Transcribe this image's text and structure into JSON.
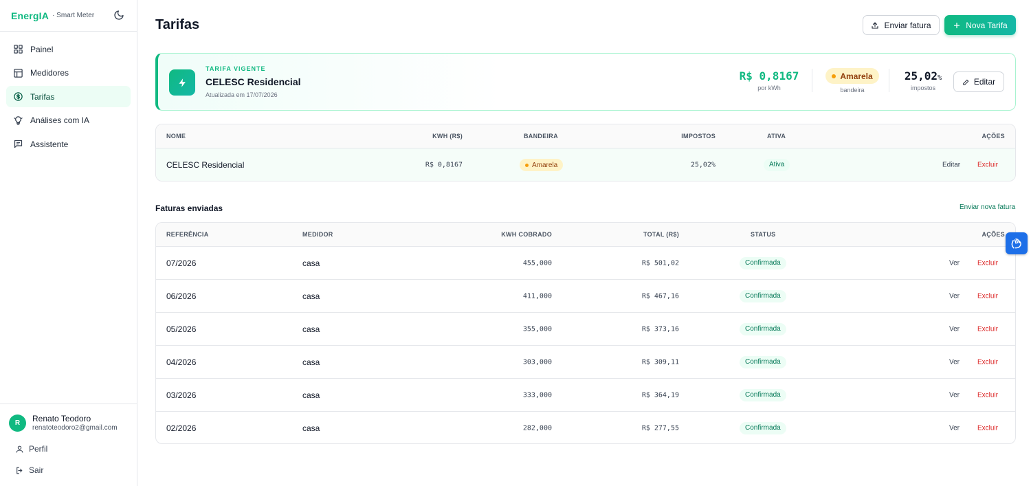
{
  "brand": {
    "name": "EnergIA",
    "subtitle": "· Smart Meter"
  },
  "sidebar": {
    "items": [
      {
        "label": "Painel",
        "icon": "grid-icon",
        "active": false
      },
      {
        "label": "Medidores",
        "icon": "table-icon",
        "active": false
      },
      {
        "label": "Tarifas",
        "icon": "dollar-circle-icon",
        "active": true
      },
      {
        "label": "Análises com IA",
        "icon": "lightbulb-icon",
        "active": false
      },
      {
        "label": "Assistente",
        "icon": "chat-icon",
        "active": false
      }
    ]
  },
  "user": {
    "initial": "R",
    "name": "Renato Teodoro",
    "email": "renatoteodoro2@gmail.com",
    "profile_label": "Perfil",
    "logout_label": "Sair"
  },
  "header": {
    "title": "Tarifas",
    "upload_label": "Enviar fatura",
    "new_label": "Nova Tarifa"
  },
  "current_tariff": {
    "label": "TARIFA VIGENTE",
    "name": "CELESC Residencial",
    "updated": "Atualizada em 17/07/2026",
    "price": "R$ 0,8167",
    "price_caption": "por kWh",
    "flag": "Amarela",
    "flag_caption": "bandeira",
    "taxes": "25,02",
    "taxes_unit": "%",
    "taxes_caption": "impostos",
    "edit_label": "Editar"
  },
  "tariffs_table": {
    "headers": {
      "name": "NOME",
      "kwh": "KWH (R$)",
      "flag": "BANDEIRA",
      "taxes": "IMPOSTOS",
      "active": "ATIVA",
      "actions": "AÇÕES"
    },
    "rows": [
      {
        "name": "CELESC Residencial",
        "kwh": "R$ 0,8167",
        "flag": "Amarela",
        "taxes": "25,02%",
        "active": "Ativa",
        "edit": "Editar",
        "delete": "Excluir"
      }
    ]
  },
  "invoices_section": {
    "title": "Faturas enviadas",
    "link": "Enviar nova fatura"
  },
  "invoices_table": {
    "headers": {
      "ref": "REFERÊNCIA",
      "meter": "MEDIDOR",
      "kwh": "KWH COBRADO",
      "total": "TOTAL (R$)",
      "status": "STATUS",
      "actions": "AÇÕES"
    },
    "rows": [
      {
        "ref": "07/2026",
        "meter": "casa",
        "kwh": "455,000",
        "total": "R$ 501,02",
        "status": "Confirmada",
        "view": "Ver",
        "delete": "Excluir"
      },
      {
        "ref": "06/2026",
        "meter": "casa",
        "kwh": "411,000",
        "total": "R$ 467,16",
        "status": "Confirmada",
        "view": "Ver",
        "delete": "Excluir"
      },
      {
        "ref": "05/2026",
        "meter": "casa",
        "kwh": "355,000",
        "total": "R$ 373,16",
        "status": "Confirmada",
        "view": "Ver",
        "delete": "Excluir"
      },
      {
        "ref": "04/2026",
        "meter": "casa",
        "kwh": "303,000",
        "total": "R$ 309,11",
        "status": "Confirmada",
        "view": "Ver",
        "delete": "Excluir"
      },
      {
        "ref": "03/2026",
        "meter": "casa",
        "kwh": "333,000",
        "total": "R$ 364,19",
        "status": "Confirmada",
        "view": "Ver",
        "delete": "Excluir"
      },
      {
        "ref": "02/2026",
        "meter": "casa",
        "kwh": "282,000",
        "total": "R$ 277,55",
        "status": "Confirmada",
        "view": "Ver",
        "delete": "Excluir"
      }
    ]
  },
  "colors": {
    "accent": "#10b981",
    "flag": "#f59e0b",
    "danger": "#dc2626",
    "a11y": "#1d6fe8"
  }
}
